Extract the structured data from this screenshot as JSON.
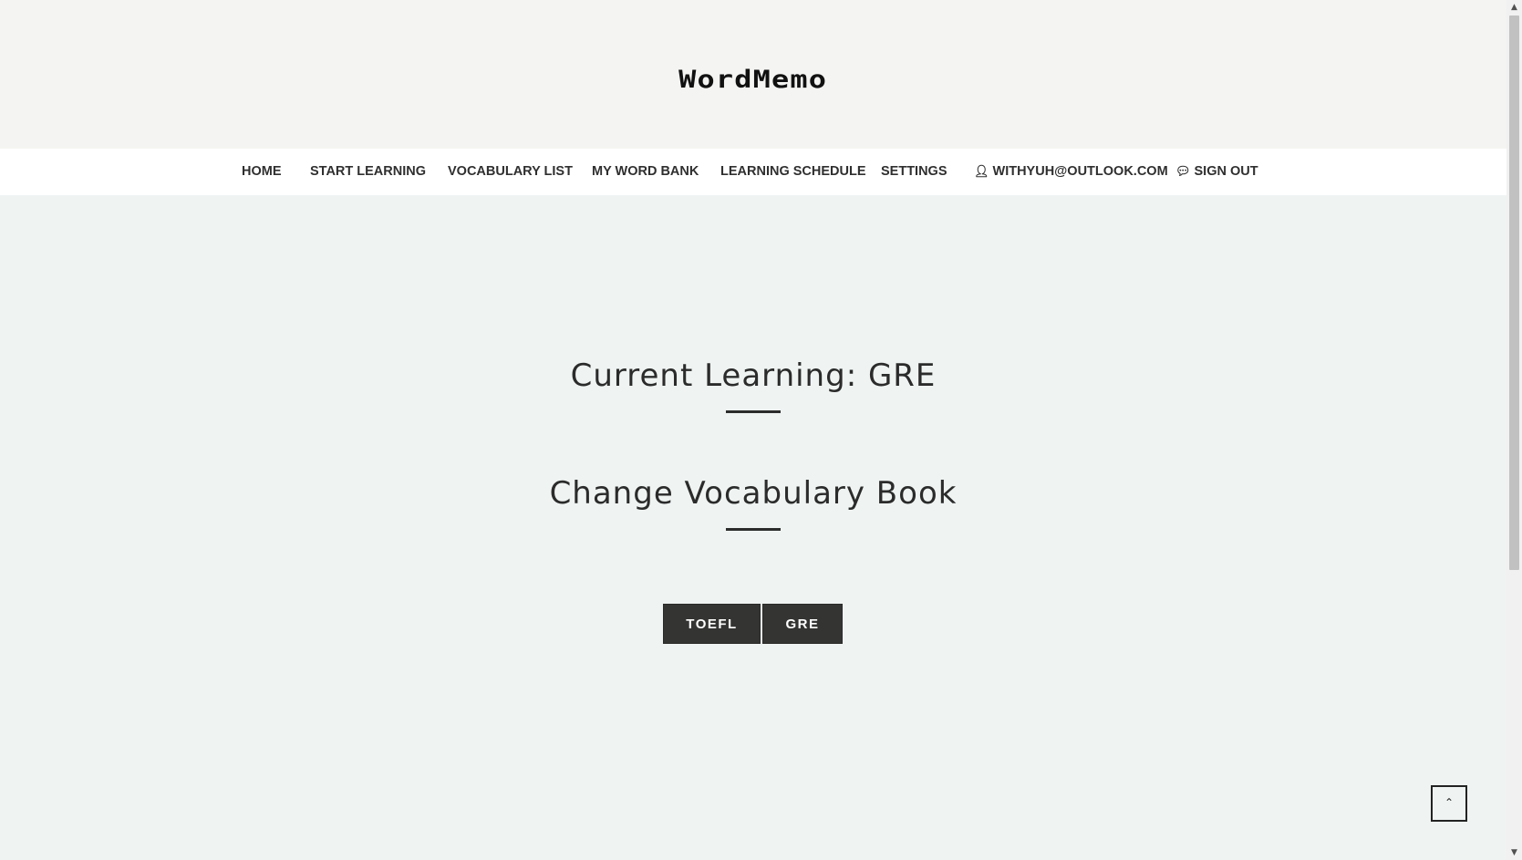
{
  "header": {
    "logo_text": "WordMemo"
  },
  "nav": {
    "items": [
      {
        "label": "HOME"
      },
      {
        "label": "START LEARNING"
      },
      {
        "label": "VOCABULARY LIST"
      },
      {
        "label": "MY WORD BANK"
      },
      {
        "label": "LEARNING SCHEDULE"
      },
      {
        "label": "SETTINGS"
      },
      {
        "label": "WITHYUH@OUTLOOK.COM",
        "icon": "user-icon"
      },
      {
        "label": "SIGN OUT",
        "icon": "comments-icon"
      }
    ]
  },
  "main": {
    "current_learning_title": "Current Learning: GRE",
    "change_book_title": "Change Vocabulary Book",
    "books": [
      {
        "label": "TOEFL"
      },
      {
        "label": "GRE"
      }
    ]
  },
  "icons": {
    "back_to_top": "double-chevron-up-icon",
    "scroll_up": "scroll-up-arrow-icon",
    "scroll_down": "scroll-down-arrow-icon"
  },
  "colors": {
    "header_bg": "#f4f4f2",
    "nav_bg": "#ffffff",
    "main_bg": "#eff4f3",
    "button_bg": "#343432",
    "text": "#2b2b2b"
  }
}
